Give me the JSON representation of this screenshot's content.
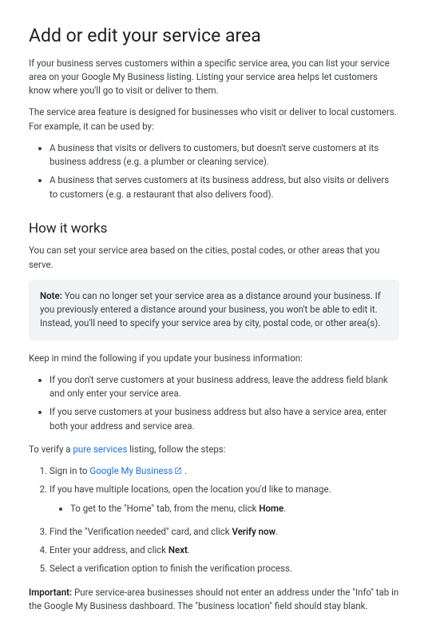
{
  "title": "Add or edit your service area",
  "intro1": "If your business serves customers within a specific service area, you can list your service area on your Google My Business listing. Listing your service area helps let customers know where you'll go to visit or deliver to them.",
  "intro2": "The service area feature is designed for businesses who visit or deliver to local customers. For example, it can be used by:",
  "examples": [
    "A business that visits or delivers to customers, but doesn't serve customers at its business address (e.g. a plumber or cleaning service).",
    "A business that serves customers at its business address, but also visits or delivers to customers (e.g. a restaurant that also delivers food)."
  ],
  "how_heading": "How it works",
  "how_intro": "You can set your service area based on the cities, postal codes, or other areas that you serve.",
  "note_label": "Note:",
  "note_body": " You can no longer set your service area as a distance around your business. If you previously entered a distance around your business, you won't be able to edit it. Instead, you'll need to specify your service area by city, postal code, or other area(s).",
  "keep_in_mind": "Keep in mind the following if you update your business information:",
  "keep_items": [
    "If you don't serve customers at your business address, leave the address field blank and only enter your service area.",
    "If you serve customers at your business address but also have a service area, enter both your address and service area."
  ],
  "verify_prefix": "To verify a ",
  "verify_link": "pure services",
  "verify_suffix": " listing, follow the steps:",
  "steps": {
    "s1a": "Sign in to ",
    "s1_link": "Google My Business",
    "s1b": " .",
    "s2": "If you have multiple locations, open the location you'd like to manage.",
    "s2_sub_a": "To get to the \"Home\" tab, from the menu, click ",
    "s2_sub_b": "Home",
    "s2_sub_c": ".",
    "s3a": "Find the \"Verification needed\" card, and click ",
    "s3b": "Verify now",
    "s3c": ".",
    "s4a": "Enter your address, and click ",
    "s4b": "Next",
    "s4c": ".",
    "s5": "Select a verification option to finish the verification process."
  },
  "important_label": "Important:",
  "important_body": " Pure service-area businesses should not enter an address under the \"Info\" tab in the Google My Business dashboard. The \"business location\" field should stay blank."
}
